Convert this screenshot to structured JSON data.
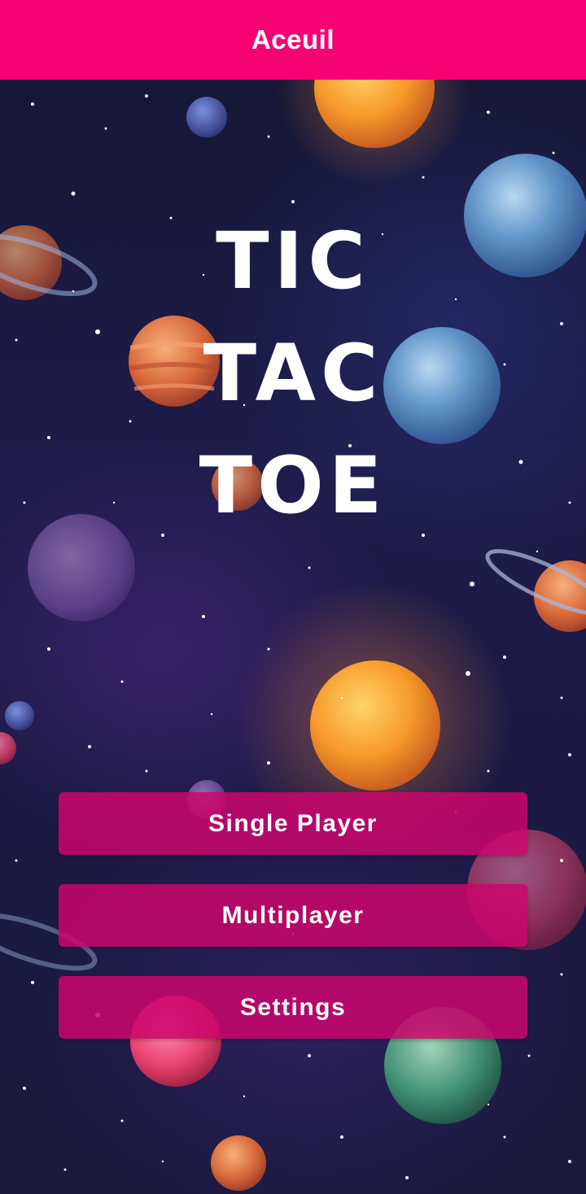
{
  "app_bar": {
    "title": "Aceuil"
  },
  "title_lines": [
    "TIC",
    "TAC",
    "TOE"
  ],
  "menu": {
    "buttons": [
      "Single Player",
      "Multiplayer",
      "Settings"
    ]
  },
  "colors": {
    "app_bar": "#f50374",
    "button": "#cb066e",
    "text": "#ffffff",
    "background": "#1b1a3e"
  }
}
